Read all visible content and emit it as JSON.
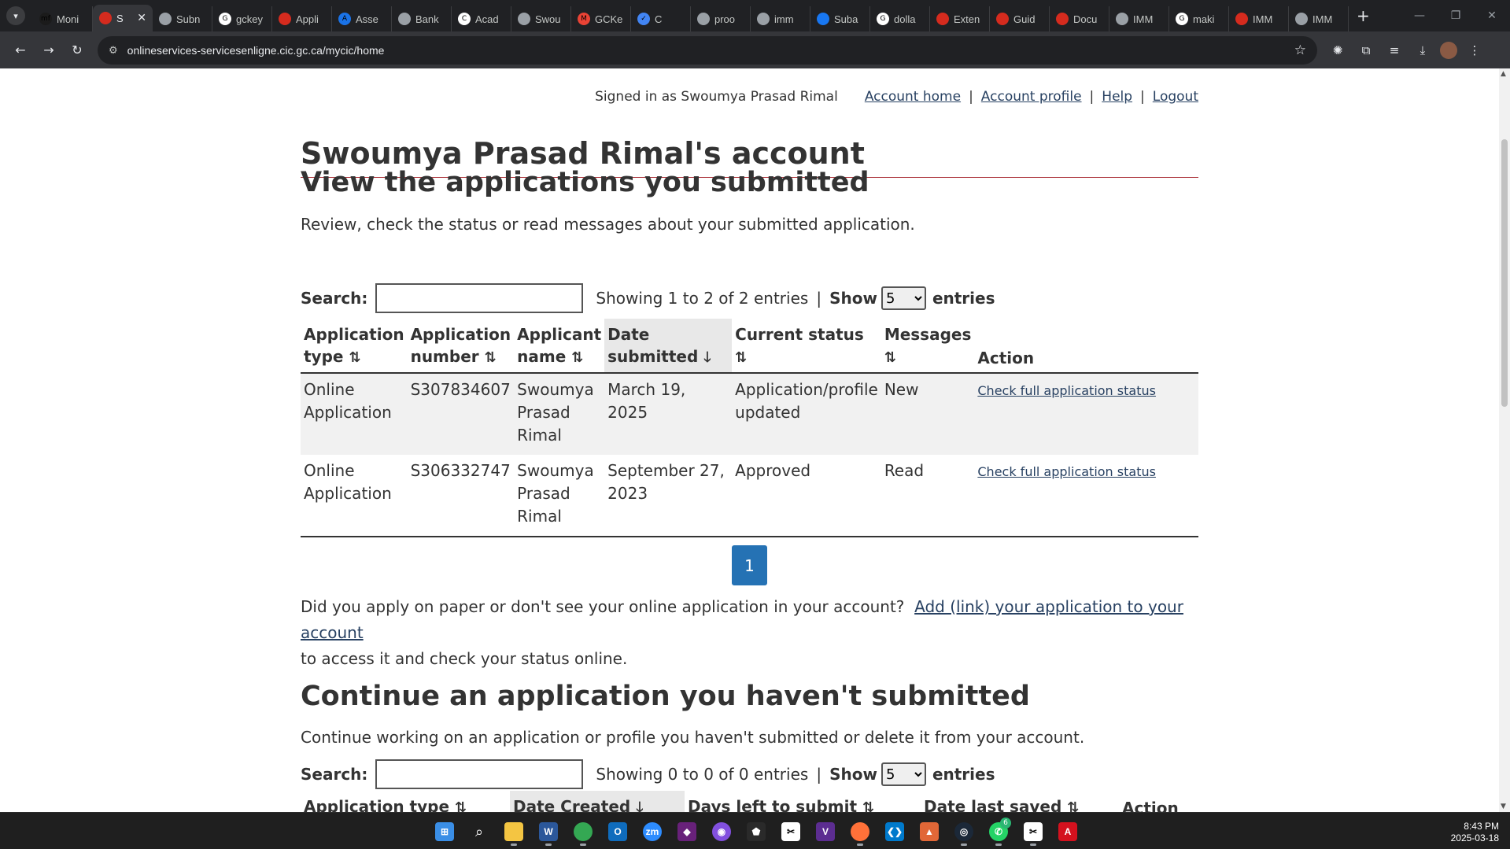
{
  "browser": {
    "tabs": [
      {
        "title": "Moni",
        "fav_color": "#1b1b1b",
        "fav_text": "mf"
      },
      {
        "title": "S",
        "fav_color": "#d52b1e",
        "fav_text": "",
        "active": true
      },
      {
        "title": "Subn",
        "fav_color": "#9aa0a6",
        "fav_text": ""
      },
      {
        "title": "gckey",
        "fav_color": "#ffffff",
        "fav_text": "G"
      },
      {
        "title": "Appli",
        "fav_color": "#d52b1e",
        "fav_text": ""
      },
      {
        "title": "Asse",
        "fav_color": "#1a73e8",
        "fav_text": "A"
      },
      {
        "title": "Bank",
        "fav_color": "#9aa0a6",
        "fav_text": ""
      },
      {
        "title": "Acad",
        "fav_color": "#ffffff",
        "fav_text": "C"
      },
      {
        "title": "Swou",
        "fav_color": "#9aa0a6",
        "fav_text": ""
      },
      {
        "title": "GCKe",
        "fav_color": "#ea4335",
        "fav_text": "M"
      },
      {
        "title": "C",
        "fav_color": "#4285f4",
        "fav_text": "✓"
      },
      {
        "title": "proo",
        "fav_color": "#9aa0a6",
        "fav_text": ""
      },
      {
        "title": "imm",
        "fav_color": "#9aa0a6",
        "fav_text": ""
      },
      {
        "title": "Suba",
        "fav_color": "#1877f2",
        "fav_text": ""
      },
      {
        "title": "dolla",
        "fav_color": "#ffffff",
        "fav_text": "G"
      },
      {
        "title": "Exten",
        "fav_color": "#d52b1e",
        "fav_text": ""
      },
      {
        "title": "Guid",
        "fav_color": "#d52b1e",
        "fav_text": ""
      },
      {
        "title": "Docu",
        "fav_color": "#d52b1e",
        "fav_text": ""
      },
      {
        "title": "IMM",
        "fav_color": "#9aa0a6",
        "fav_text": ""
      },
      {
        "title": "maki",
        "fav_color": "#ffffff",
        "fav_text": "G"
      },
      {
        "title": "IMM",
        "fav_color": "#d52b1e",
        "fav_text": ""
      },
      {
        "title": "IMM",
        "fav_color": "#9aa0a6",
        "fav_text": ""
      }
    ],
    "url": "onlineservices-servicesenligne.cic.gc.ca/mycic/home"
  },
  "header": {
    "signed_in": "Signed in as Swoumya Prasad Rimal",
    "links": [
      "Account home",
      "Account profile",
      "Help",
      "Logout"
    ]
  },
  "page_title": "Swoumya Prasad Rimal's account",
  "submitted": {
    "heading": "View the applications you submitted",
    "intro": "Review, check the status or read messages about your submitted application.",
    "search_label": "Search:",
    "showing": "Showing 1 to 2 of 2 entries",
    "show_label": "Show",
    "show_value": "5",
    "entries_label": "entries",
    "columns": [
      "Application type",
      "Application number",
      "Applicant name",
      "Date submitted",
      "Current status",
      "Messages",
      "Action"
    ],
    "rows": [
      {
        "type": "Online Application",
        "number": "S307834607",
        "name": "Swoumya Prasad Rimal",
        "date": "March 19, 2025",
        "status": "Application/profile updated",
        "messages": "New",
        "action": "Check full application status"
      },
      {
        "type": "Online Application",
        "number": "S306332747",
        "name": "Swoumya Prasad Rimal",
        "date": "September 27, 2023",
        "status": "Approved",
        "messages": "Read",
        "action": "Check full application status"
      }
    ],
    "page": "1"
  },
  "paper_note": {
    "text_before": "Did you apply on paper or don't see your online application in your account?",
    "link": "Add (link) your application to your account",
    "text_after": "to access it and check your status online."
  },
  "unsubmitted": {
    "heading": "Continue an application you haven't submitted",
    "intro": "Continue working on an application or profile you haven't submitted or delete it from your account.",
    "search_label": "Search:",
    "showing": "Showing 0 to 0 of 0 entries",
    "show_label": "Show",
    "show_value": "5",
    "entries_label": "entries",
    "columns": [
      "Application type",
      "Date Created",
      "Days left to submit",
      "Date last saved",
      "Action"
    ]
  },
  "taskbar": {
    "time": "8:43 PM",
    "date": "2025-03-18",
    "whatsapp_badge": "6"
  },
  "colors": {
    "link": "#284162",
    "accent_rule": "#af3c43",
    "pager": "#2572b4"
  }
}
